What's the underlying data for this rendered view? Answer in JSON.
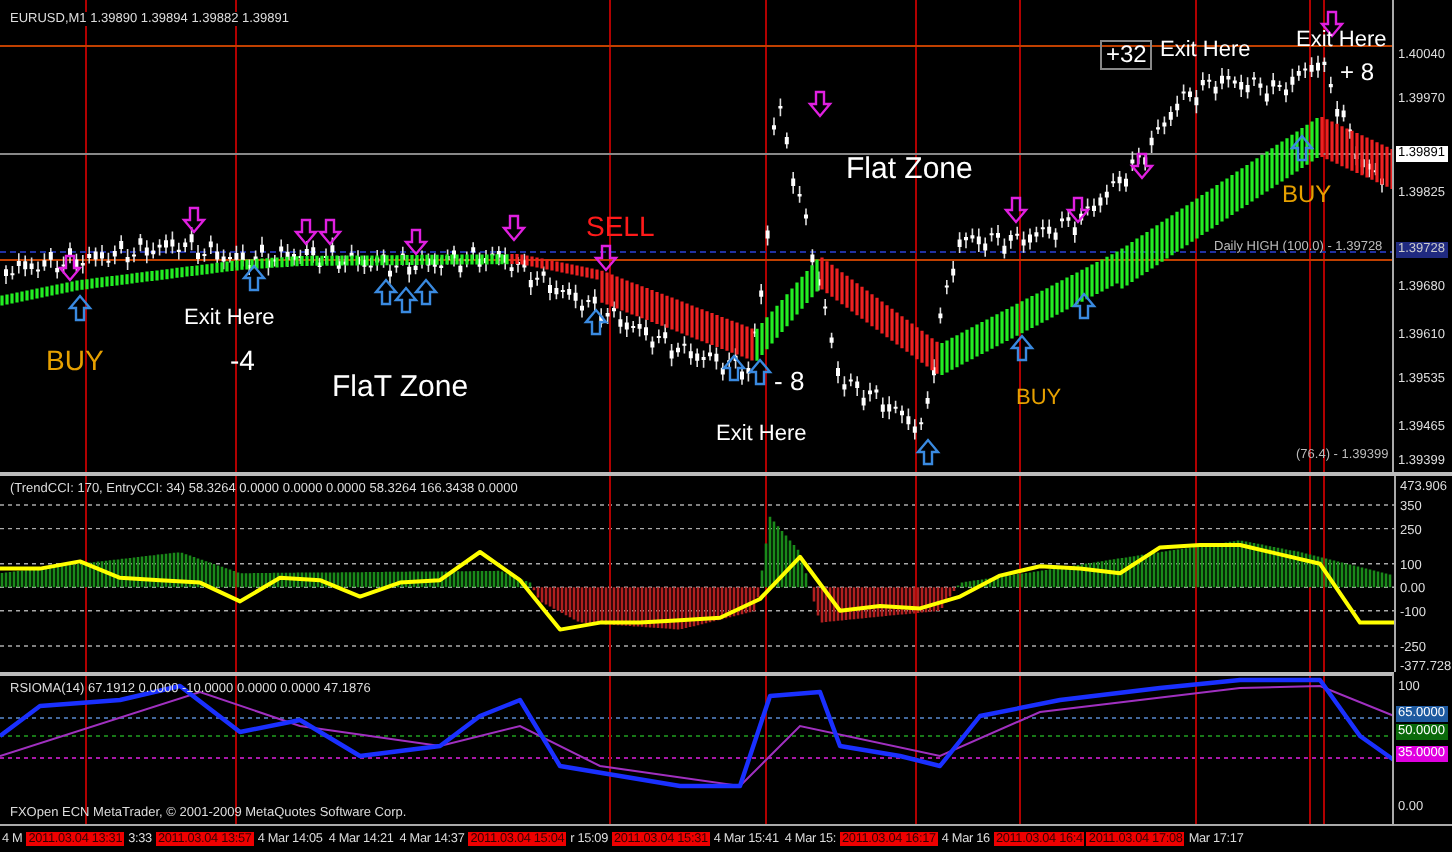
{
  "main_chart": {
    "title": "EURUSD,M1  1.39890 1.39894 1.39882 1.39891",
    "annotations": [
      {
        "text": "+32",
        "kind": "boxed",
        "color": "#ffffff"
      },
      {
        "text": "Exit Here",
        "kind": "label",
        "color": "#ffffff"
      },
      {
        "text": "Exit Here",
        "kind": "label",
        "color": "#ffffff"
      },
      {
        "text": "+ 8",
        "kind": "label",
        "color": "#ffffff"
      },
      {
        "text": "Flat Zone",
        "kind": "label",
        "color": "#ffffff"
      },
      {
        "text": "BUY",
        "kind": "label",
        "color": "#e6a000"
      },
      {
        "text": "SELL",
        "kind": "label",
        "color": "#ff1a1a"
      },
      {
        "text": "Exit Here",
        "kind": "label",
        "color": "#ffffff"
      },
      {
        "text": "BUY",
        "kind": "label",
        "color": "#e6a000"
      },
      {
        "text": "-4",
        "kind": "label",
        "color": "#ffffff"
      },
      {
        "text": "FlaT Zone",
        "kind": "label",
        "color": "#ffffff"
      },
      {
        "text": "- 8",
        "kind": "label",
        "color": "#ffffff"
      },
      {
        "text": "Exit Here",
        "kind": "label",
        "color": "#ffffff"
      },
      {
        "text": "BUY",
        "kind": "label",
        "color": "#e6a000"
      }
    ],
    "level_labels": [
      "Daily HIGH (100.0) - 1.39728",
      "(76.4) - 1.39399"
    ],
    "price_axis": [
      {
        "text": "1.40040",
        "kind": "tick"
      },
      {
        "text": "1.39970",
        "kind": "tick"
      },
      {
        "text": "1.39891",
        "kind": "current"
      },
      {
        "text": "1.39825",
        "kind": "tick"
      },
      {
        "text": "1.39728",
        "kind": "marker"
      },
      {
        "text": "1.39680",
        "kind": "tick"
      },
      {
        "text": "1.39610",
        "kind": "tick"
      },
      {
        "text": "1.39535",
        "kind": "tick"
      },
      {
        "text": "1.39465",
        "kind": "tick"
      },
      {
        "text": "1.39399",
        "kind": "tick"
      }
    ]
  },
  "cci_panel": {
    "title": "(TrendCCI: 170, EntryCCI: 34) 58.3264 0.0000 0.0000 0.0000 58.3264 166.3438 0.0000",
    "chart_data": {
      "type": "line",
      "grid": true,
      "ylim": [
        -377.728,
        473.906
      ],
      "yticks": [
        {
          "value": 473.906,
          "label": "473.906"
        },
        350,
        250,
        100,
        {
          "value": 0,
          "label": "0.00"
        },
        -100,
        -250,
        {
          "value": -377.728,
          "label": "-377.728"
        }
      ],
      "series": [
        {
          "color": "#ffff00",
          "values": [
            80,
            80,
            110,
            40,
            30,
            20,
            -60,
            40,
            30,
            -40,
            20,
            30,
            150,
            30,
            -180,
            -150,
            -150,
            -140,
            -130,
            -50,
            130,
            -100,
            -80,
            -90,
            -40,
            50,
            90,
            80,
            60,
            170,
            180,
            180,
            140,
            100,
            -150,
            -150
          ]
        }
      ]
    }
  },
  "rsi_panel": {
    "title": "RSIOMA(14) 67.1912 0.0000 -10.0000 0.0000 0.0000 47.1876",
    "copyright": "FXOpen ECN MetaTrader, © 2001-2009 MetaQuotes Software Corp.",
    "axis": [
      {
        "text": "100",
        "kind": "tick"
      },
      {
        "text": "65.0000",
        "kind": "level",
        "color": "#1e5aa0"
      },
      {
        "text": "50.0000",
        "kind": "level",
        "color": "#0a6a0a"
      },
      {
        "text": "35.0000",
        "kind": "level",
        "color": "#e000e0"
      },
      {
        "text": "0.00",
        "kind": "tick"
      }
    ]
  },
  "time_axis": [
    {
      "text": "4 M",
      "kind": "label"
    },
    {
      "text": "2011.03.04 13:31",
      "kind": "marker"
    },
    {
      "text": "3:33",
      "kind": "label"
    },
    {
      "text": "2011.03.04 13:57",
      "kind": "marker"
    },
    {
      "text": "4 Mar 14:05",
      "kind": "label"
    },
    {
      "text": "4 Mar 14:21",
      "kind": "label"
    },
    {
      "text": "4 Mar 14:37",
      "kind": "label"
    },
    {
      "text": "2011.03.04 15:04",
      "kind": "marker"
    },
    {
      "text": "r 15:09",
      "kind": "label"
    },
    {
      "text": "2011.03.04 15:31",
      "kind": "marker"
    },
    {
      "text": "4 Mar 15:41",
      "kind": "label"
    },
    {
      "text": "4 Mar 15:",
      "kind": "label"
    },
    {
      "text": "2011.03.04 16:17",
      "kind": "marker"
    },
    {
      "text": "4 Mar 16",
      "kind": "label"
    },
    {
      "text": "2011.03.04 16:4",
      "kind": "marker"
    },
    {
      "text": "2011.03.04 17:08",
      "kind": "marker"
    },
    {
      "text": "Mar 17:17",
      "kind": "label"
    }
  ]
}
